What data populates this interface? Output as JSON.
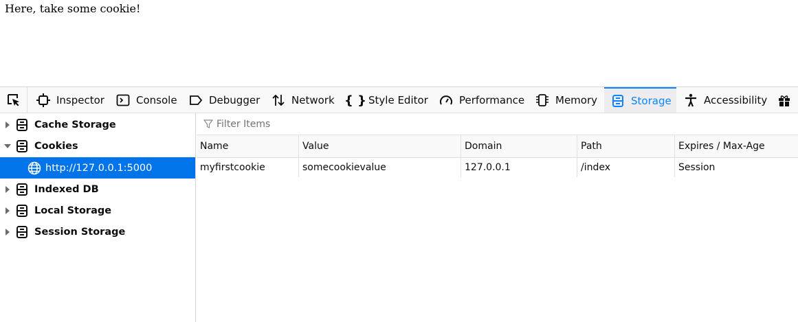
{
  "page": {
    "text": "Here, take some cookie!"
  },
  "toolbar": {
    "tabs": [
      {
        "label": "Inspector"
      },
      {
        "label": "Console"
      },
      {
        "label": "Debugger"
      },
      {
        "label": "Network"
      },
      {
        "label": "Style Editor"
      },
      {
        "label": "Performance"
      },
      {
        "label": "Memory"
      },
      {
        "label": "Storage",
        "selected": true
      },
      {
        "label": "Accessibility"
      }
    ]
  },
  "sidebar": {
    "items": [
      {
        "label": "Cache Storage",
        "expanded": false
      },
      {
        "label": "Cookies",
        "expanded": true
      },
      {
        "label": "http://127.0.0.1:5000",
        "selected": true
      },
      {
        "label": "Indexed DB",
        "expanded": false
      },
      {
        "label": "Local Storage",
        "expanded": false
      },
      {
        "label": "Session Storage",
        "expanded": false
      }
    ]
  },
  "filter": {
    "placeholder": "Filter Items"
  },
  "table": {
    "columns": [
      "Name",
      "Value",
      "Domain",
      "Path",
      "Expires / Max-Age"
    ],
    "rows": [
      [
        "myfirstcookie",
        "somecookievalue",
        "127.0.0.1",
        "/index",
        "Session"
      ]
    ]
  },
  "colors": {
    "accent": "#0a84ff",
    "selection": "#0074e8"
  }
}
